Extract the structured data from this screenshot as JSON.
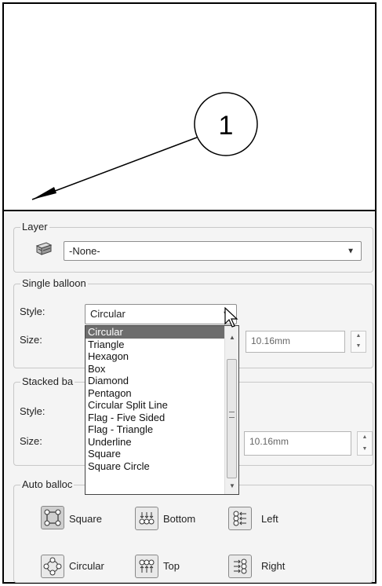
{
  "drawing": {
    "balloon_number": "1"
  },
  "layer": {
    "legend": "Layer",
    "selected": "-None-"
  },
  "single_balloon": {
    "legend": "Single balloon",
    "style_label": "Style:",
    "style_value": "Circular",
    "size_label": "Size:",
    "size_value": "10.16mm"
  },
  "style_dropdown": {
    "items": [
      "Circular",
      "Triangle",
      "Hexagon",
      "Box",
      "Diamond",
      "Pentagon",
      "Circular Split Line",
      "Flag - Five Sided",
      "Flag - Triangle",
      "Underline",
      "Square",
      "Square Circle"
    ],
    "selected_index": 0
  },
  "stacked_balloons": {
    "legend": "Stacked ba",
    "style_label": "Style:",
    "size_label": "Size:",
    "size_value": "10.16mm"
  },
  "auto_balloon": {
    "legend": "Auto balloc",
    "square": "Square",
    "bottom": "Bottom",
    "left": "Left",
    "circular": "Circular",
    "top": "Top",
    "right": "Right"
  }
}
